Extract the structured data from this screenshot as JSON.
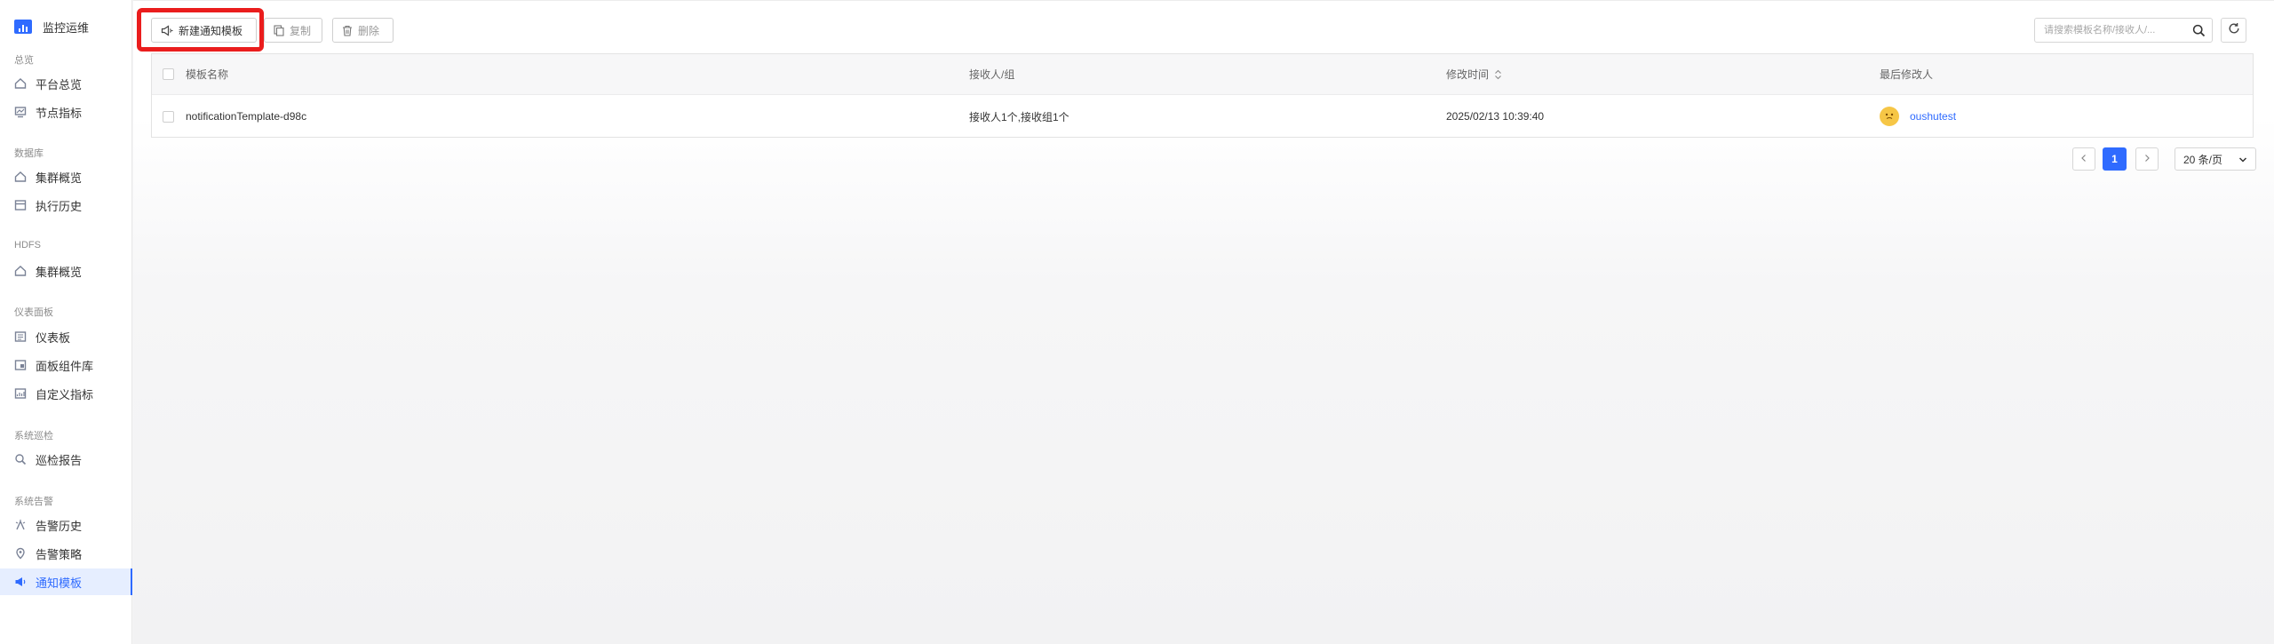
{
  "app": {
    "title": "监控运维"
  },
  "sidebar": {
    "sections": [
      {
        "label": "总览"
      },
      {
        "label": "数据库"
      },
      {
        "label": "HDFS"
      },
      {
        "label": "仪表面板"
      },
      {
        "label": "系统巡检"
      },
      {
        "label": "系统告警"
      }
    ],
    "items": [
      {
        "label": "平台总览",
        "icon": "home-icon"
      },
      {
        "label": "节点指标",
        "icon": "monitor-icon"
      },
      {
        "label": "集群概览",
        "icon": "home-icon"
      },
      {
        "label": "执行历史",
        "icon": "history-icon"
      },
      {
        "label": "集群概览",
        "icon": "home-icon"
      },
      {
        "label": "仪表板",
        "icon": "dashboard-icon"
      },
      {
        "label": "面板组件库",
        "icon": "component-library-icon"
      },
      {
        "label": "自定义指标",
        "icon": "custom-metric-icon"
      },
      {
        "label": "巡检报告",
        "icon": "inspection-report-icon"
      },
      {
        "label": "告警历史",
        "icon": "alert-history-icon"
      },
      {
        "label": "告警策略",
        "icon": "alert-policy-icon"
      },
      {
        "label": "通知模板",
        "icon": "megaphone-icon",
        "active": true
      }
    ]
  },
  "toolbar": {
    "new_label": "新建通知模板",
    "copy_label": "复制",
    "delete_label": "删除",
    "step_marker": "①"
  },
  "search": {
    "placeholder": "请搜索模板名称/接收人/...",
    "value": ""
  },
  "table": {
    "columns": [
      "模板名称",
      "接收人/组",
      "修改时间",
      "最后修改人"
    ],
    "rows": [
      {
        "name": "notificationTemplate-d98c",
        "recipients": "接收人1个,接收组1个",
        "modified_time": "2025/02/13 10:39:40",
        "last_modifier": "oushutest"
      }
    ]
  },
  "pagination": {
    "current_page": "1",
    "page_size": "20 条/页"
  },
  "colors": {
    "accent": "#2f6bff",
    "highlight": "#ea1d1d"
  }
}
